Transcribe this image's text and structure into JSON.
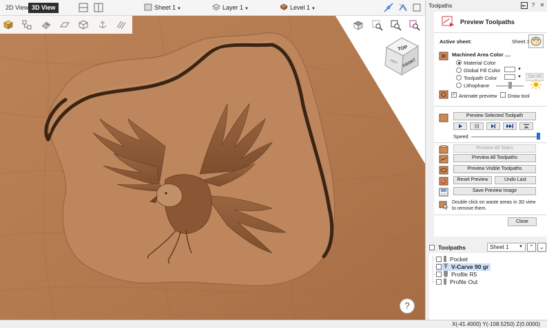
{
  "toolbar": {
    "tab_2d": "2D View",
    "tab_3d": "3D View",
    "sheet": "Sheet 1",
    "layer": "Layer 1",
    "level": "Level 1",
    "icons": [
      "layout-single-icon",
      "layout-split-icon",
      "sheet-icon",
      "layer-icon",
      "level-icon",
      "snap-icon",
      "transform-icon",
      "window-icon"
    ]
  },
  "viewport": {
    "tools": [
      "material-block-icon",
      "toolpath-tree-icon",
      "lighting-icon",
      "plane-icon",
      "box-outline-icon",
      "anchor-icon",
      "line-pattern-icon"
    ],
    "view_tools": [
      "view-cube-toggle-icon",
      "zoom-extents-icon",
      "zoom-region-icon",
      "zoom-selection-icon"
    ],
    "view_cube": {
      "top": "TOP",
      "front": "FRONT",
      "left": "LEFT"
    },
    "help": "?"
  },
  "status": {
    "coords": "X(-41.4000) Y(-108.5250) Z(0.0000)"
  },
  "panel": {
    "title": "Toolpaths",
    "form_title": "Preview Toolpaths",
    "active_sheet_label": "Active sheet:",
    "active_sheet_value": "Sheet 1",
    "machined_color_label": "Machined Area Color ....",
    "options": [
      "Material Color",
      "Global Fill Color",
      "Toolpath Color",
      "Lithophane"
    ],
    "selected_option": 0,
    "set_all": "Set All",
    "animate_preview": "Animate preview",
    "draw_tool": "Draw tool",
    "preview_selected": "Preview Selected Toolpath",
    "speed": "Speed",
    "speed_level": 0.98,
    "lithophane_level": 0.5,
    "preview_all_sides": "Preview All Sides",
    "preview_all": "Preview All Toolpaths",
    "preview_visible": "Preview Visible Toolpaths",
    "reset_preview": "Reset Preview",
    "undo_last": "Undo Last",
    "save_image": "Save Preview Image",
    "hint_line1": "Double click on waste areas in 3D view",
    "hint_line2": "to remove them.",
    "close": "Close"
  },
  "toolpath_list": {
    "title": "Toolpaths",
    "sheet": "Sheet 1",
    "items": [
      {
        "name": "Pocket",
        "active": false
      },
      {
        "name": "V-Carve 90 gr",
        "active": true
      },
      {
        "name": "Profile R5",
        "active": false
      },
      {
        "name": "Profile Out",
        "active": false
      }
    ]
  },
  "colors": {
    "wood": "#b47a4f",
    "accent": "#1e6fd9",
    "selection": "#cfe1f7"
  }
}
